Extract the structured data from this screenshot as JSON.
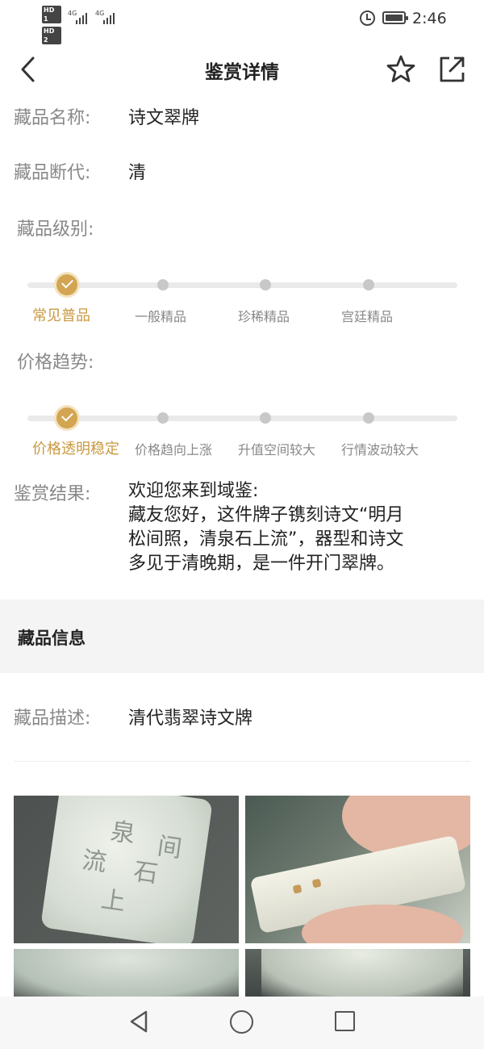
{
  "status_bar": {
    "sim1": "HD 1",
    "sim2": "HD 2",
    "net1": "4G",
    "net2": "4G",
    "time": "2:46",
    "icons": [
      "signal-icon",
      "alarm-icon",
      "battery-icon"
    ]
  },
  "header": {
    "title": "鉴赏详情",
    "icons": [
      "back-arrow-icon",
      "star-icon",
      "share-icon"
    ]
  },
  "details": {
    "name_label": "藏品名称:",
    "name_value": "诗文翠牌",
    "dynasty_label": "藏品断代:",
    "dynasty_value": "清"
  },
  "grade": {
    "label": "藏品级别:",
    "selected_index": 0,
    "steps": [
      "常见普品",
      "一般精品",
      "珍稀精品",
      "宫廷精品"
    ]
  },
  "price_trend": {
    "label": "价格趋势:",
    "selected_index": 0,
    "steps": [
      "价格透明稳定",
      "价格趋向上涨",
      "升值空间较大",
      "行情波动较大"
    ]
  },
  "result": {
    "label": "鉴赏结果:",
    "lines": [
      "欢迎您来到域鉴:",
      "藏友您好，这件牌子镌刻诗文“明月",
      "松间照，清泉石上流”，器型和诗文",
      "多见于清晚期，是一件开门翠牌。"
    ]
  },
  "collection_info": {
    "section_title": "藏品信息",
    "desc_label": "藏品描述:",
    "desc_value": "清代翡翠诗文牌",
    "photo_glyphs": [
      "泉",
      "流",
      "石",
      "上",
      "间"
    ]
  },
  "nav": {
    "icons": [
      "nav-back-icon",
      "nav-home-icon",
      "nav-recent-icon"
    ]
  },
  "colors": {
    "accent": "#d3a552",
    "accent_text": "#c9993f",
    "label_gray": "#888888",
    "band_bg": "#f4f4f4"
  }
}
